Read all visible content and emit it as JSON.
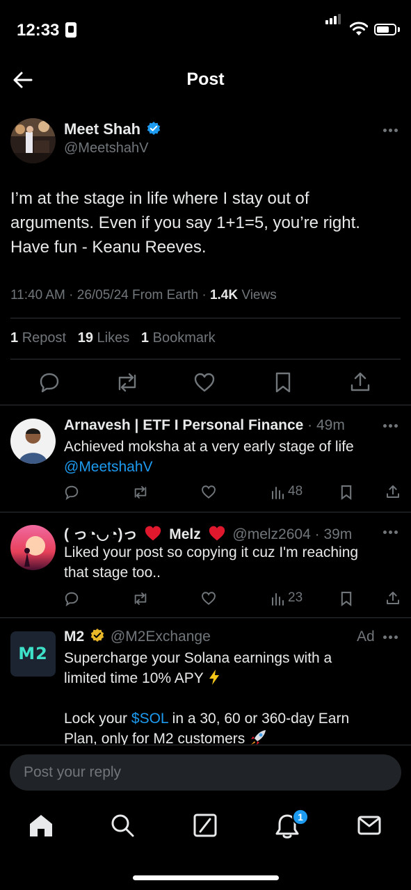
{
  "status_bar": {
    "time": "12:33"
  },
  "header": {
    "title": "Post"
  },
  "post": {
    "author_name": "Meet Shah",
    "author_handle": "@MeetshahV",
    "text_lines": [
      "I’m at the stage in life where I stay out of",
      "arguments. Even if you say 1+1=5, you’re right.",
      "Have fun - Keanu Reeves."
    ],
    "meta": {
      "time": "11:40 AM",
      "date": "26/05/24",
      "location": "From Earth",
      "views_count": "1.4K",
      "views_label": "Views"
    },
    "stats": {
      "reposts_count": "1",
      "reposts_label": "Repost",
      "likes_count": "19",
      "likes_label": "Likes",
      "bookmarks_count": "1",
      "bookmarks_label": "Bookmark"
    }
  },
  "replies": [
    {
      "name": "Arnavesh | ETF I Personal Finance",
      "time": "49m",
      "lines": [
        "Achieved moksha at a very early stage of life"
      ],
      "mention": "@MeetshahV",
      "views": "48"
    },
    {
      "name_prefix": "( っ◔◡◔)っ",
      "name": "Melz",
      "handle": "@melz2604",
      "time": "39m",
      "lines": [
        "Liked your post so copying it cuz I'm reaching",
        "that stage too.."
      ],
      "views": "23"
    }
  ],
  "ad": {
    "name": "M2",
    "handle": "@M2Exchange",
    "ad_label": "Ad",
    "logo_text": "M2",
    "line1": "Supercharge your Solana earnings with a",
    "line2": "limited time 10% APY",
    "line3_pre": "Lock your",
    "cashtag": "$SOL",
    "line3_post": "in a 30, 60 or 360-day Earn",
    "line4": "Plan, only for M2 customers"
  },
  "reply_box": {
    "placeholder": "Post your reply"
  },
  "tabbar": {
    "notifications_badge": "1"
  },
  "colors": {
    "accent": "#1d9bf0",
    "muted": "#71767b",
    "background": "#000000",
    "gold": "#e8b829"
  },
  "icons": [
    "back-arrow-icon",
    "verified-badge-icon",
    "more-icon",
    "reply-icon",
    "repost-icon",
    "like-icon",
    "bookmark-icon",
    "share-icon",
    "views-icon",
    "home-icon",
    "search-icon",
    "grok-icon",
    "notifications-icon",
    "messages-icon"
  ]
}
